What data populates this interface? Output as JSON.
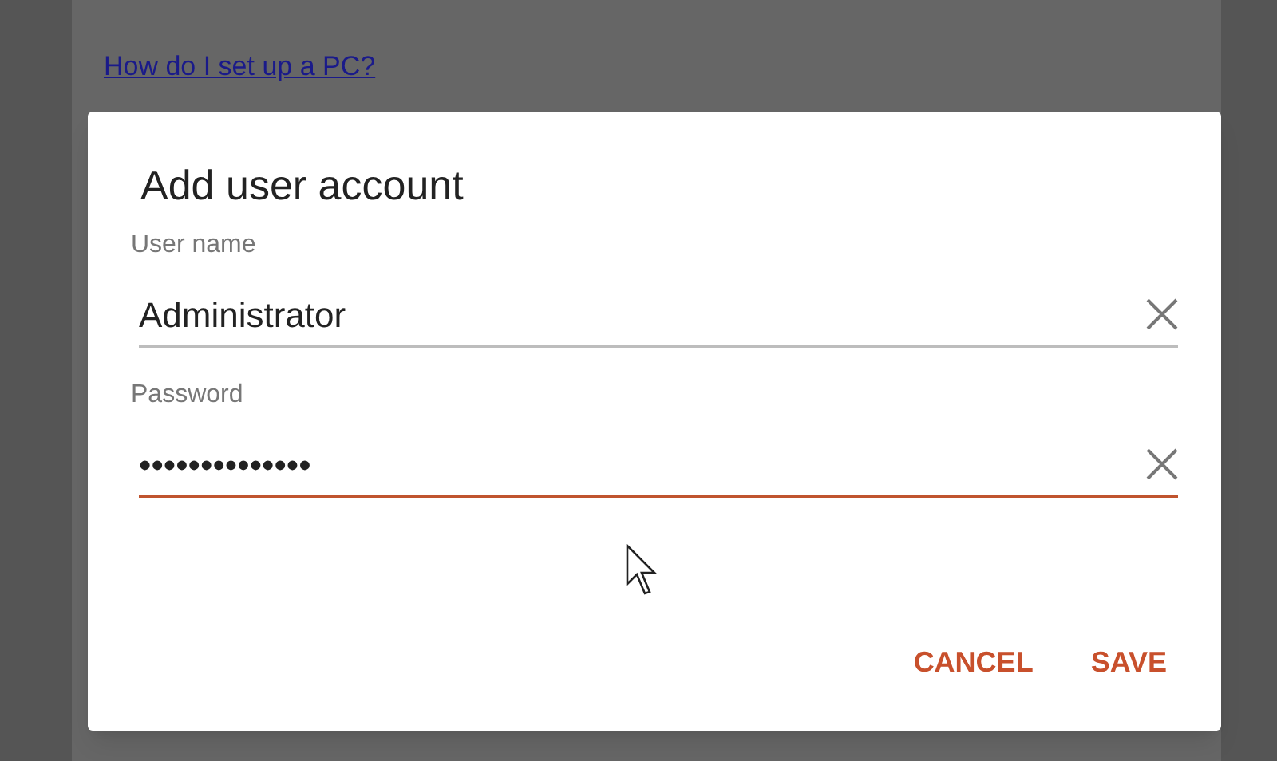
{
  "background_link": {
    "label": "How do I set up a PC?"
  },
  "dialog": {
    "title": "Add user account",
    "fields": [
      {
        "label": "User name",
        "value": "Administrator",
        "focused": false
      },
      {
        "label": "Password",
        "value": "••••••••••••••",
        "focused": true
      }
    ],
    "buttons": [
      "CANCEL",
      "SAVE"
    ]
  }
}
